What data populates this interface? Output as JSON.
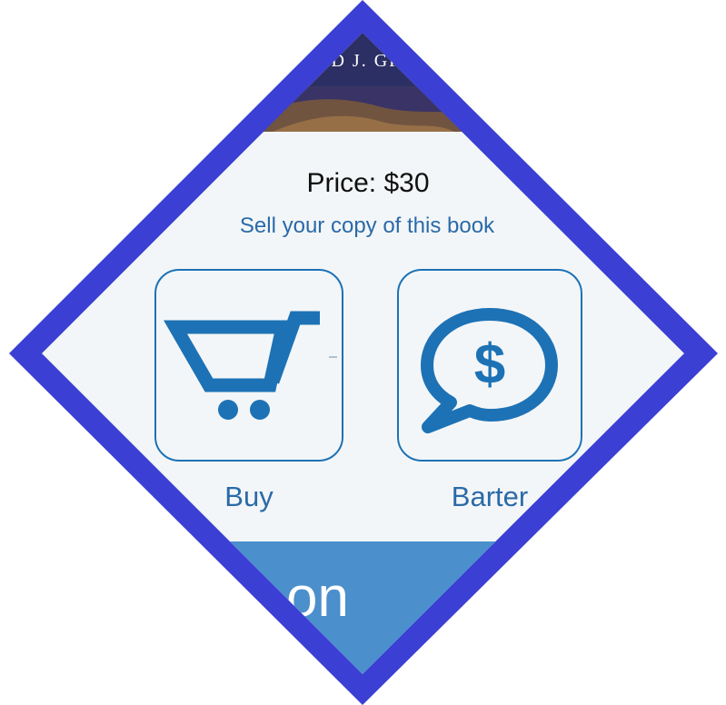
{
  "book": {
    "author_fragment": "D J. GR"
  },
  "price": {
    "label": "Price: $30"
  },
  "sell": {
    "link_text": "Sell your copy of this book"
  },
  "actions": {
    "buy_label": "Buy",
    "barter_label": "Barter"
  },
  "bottom_button": {
    "label_fragment": "on"
  },
  "colors": {
    "frame": "#3b3fd4",
    "panel": "#f3f6f8",
    "accent": "#1d72b5",
    "button_bg": "#4b8fcc",
    "cover": "#2c2f63"
  },
  "icons": {
    "buy": "shopping-cart-icon",
    "barter": "dollar-speech-bubble-icon"
  }
}
